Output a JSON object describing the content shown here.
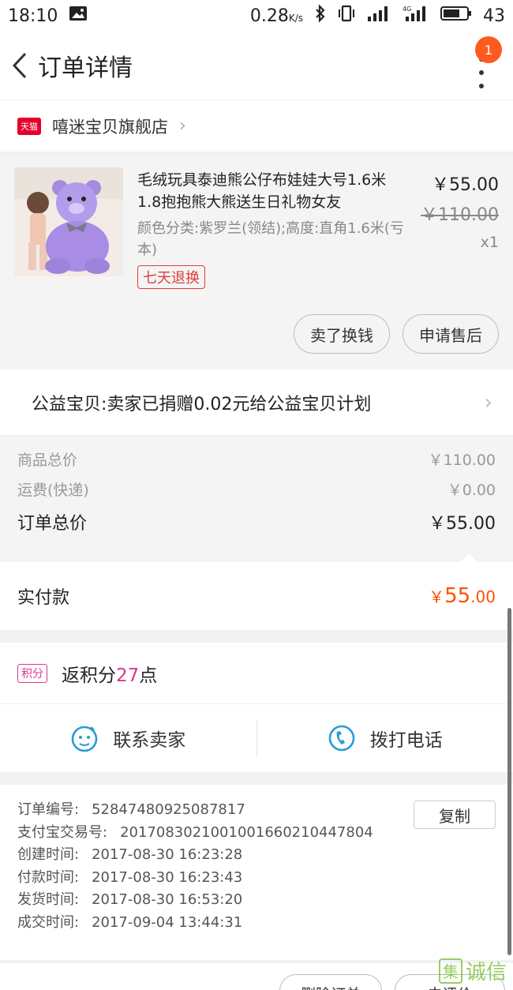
{
  "status_bar": {
    "time": "18:10",
    "speed": "0.28",
    "speed_unit": "K/s",
    "battery": "43"
  },
  "header": {
    "title": "订单详情",
    "badge": "1"
  },
  "shop": {
    "tag": "天猫",
    "name": "嘻迷宝贝旗舰店"
  },
  "product": {
    "name": "毛绒玩具泰迪熊公仔布娃娃大号1.6米1.8抱抱熊大熊送生日礼物女友",
    "spec": "颜色分类:紫罗兰(领结);高度:直角1.6米(亏本)",
    "refund_tag": "七天退换",
    "price": "￥55.00",
    "original_price": "￥110.00",
    "quantity": "x1",
    "btn_sell": "卖了换钱",
    "btn_aftersale": "申请售后"
  },
  "charity": {
    "text": "公益宝贝:卖家已捐赠0.02元给公益宝贝计划"
  },
  "summary": {
    "goods_total_label": "商品总价",
    "goods_total": "￥110.00",
    "shipping_label": "运费(快递)",
    "shipping": "￥0.00",
    "order_total_label": "订单总价",
    "order_total": "￥55.00"
  },
  "paid": {
    "label": "实付款",
    "currency": "￥",
    "int": "55",
    "dec": ".00"
  },
  "points": {
    "tag": "积分",
    "prefix": "返积分",
    "num": "27",
    "suffix": "点"
  },
  "contact": {
    "seller": "联系卖家",
    "phone": "拨打电话"
  },
  "meta": {
    "copy": "复制",
    "rows": [
      {
        "k": "订单编号:",
        "v": "52847480925087817"
      },
      {
        "k": "支付宝交易号:",
        "v": "2017083021001001660210447804"
      },
      {
        "k": "创建时间:",
        "v": "2017-08-30 16:23:28"
      },
      {
        "k": "付款时间:",
        "v": "2017-08-30 16:23:43"
      },
      {
        "k": "发货时间:",
        "v": "2017-08-30 16:53:20"
      },
      {
        "k": "成交时间:",
        "v": "2017-09-04 13:44:31"
      }
    ]
  },
  "bottom": {
    "delete": "删除订单",
    "review": "去评价"
  },
  "watermark": {
    "box": "集",
    "text": "诚信"
  }
}
